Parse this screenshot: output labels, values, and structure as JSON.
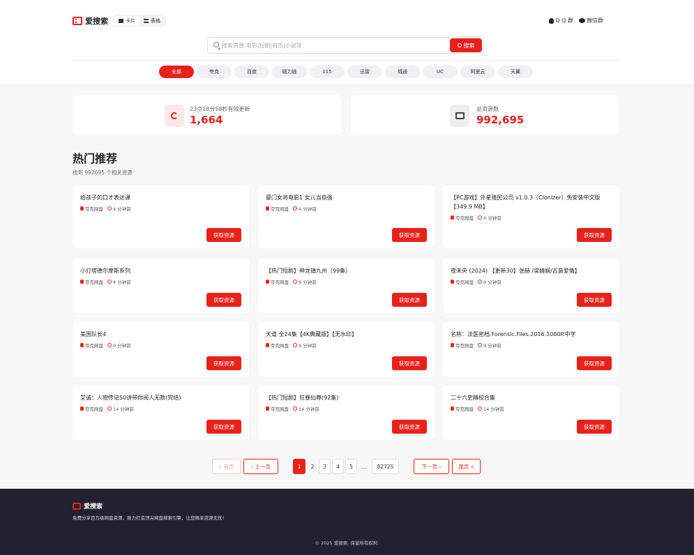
{
  "header": {
    "logo_text": "爱搜索",
    "view_toggle": [
      {
        "label": "卡片",
        "icon": "grid-icon",
        "active": true
      },
      {
        "label": "表格",
        "icon": "list-icon",
        "active": false
      }
    ],
    "groups": [
      {
        "label": "Q Q 群",
        "icon": "qq-icon"
      },
      {
        "label": "微信群",
        "icon": "wechat-icon"
      }
    ]
  },
  "search": {
    "placeholder": "搜索资源:电影|短剧|音乐|小说等",
    "button_label": "搜索"
  },
  "tabs": [
    "全部",
    "夸克",
    "百度",
    "磁力链",
    "115",
    "迅雷",
    "城通",
    "UC",
    "阿里云",
    "天翼"
  ],
  "stats": {
    "update": {
      "label": "23点18分58秒有效更新",
      "value": "1,664"
    },
    "total": {
      "label": "总资源数",
      "value": "992,695"
    }
  },
  "section": {
    "title": "热门推荐",
    "subtitle": "找到 992695 个相关资源"
  },
  "cards": [
    {
      "title": "给孩子的口才表达课",
      "source": "夸克网盘",
      "time": "4 分钟前"
    },
    {
      "title": "豪门女将电影1 女儿当自强",
      "source": "夸克网盘",
      "time": "4 分钟前"
    },
    {
      "title": "【PC游戏】外星殖民公司 v1.0.3（Clonizer）免安装中文版【349.9 MB】",
      "source": "夸克网盘",
      "time": "4 分钟前"
    },
    {
      "title": "小灯塔德尔摩斯系列",
      "source": "夸克网盘",
      "time": "4 分钟前"
    },
    {
      "title": "【热门短剧】神龙镇九州（99集）",
      "source": "夸克网盘",
      "time": "9 分钟前"
    },
    {
      "title": "夜未央 (2024) 【更新30】张赫 /梁婧娴/古装爱情】",
      "source": "夸克网盘",
      "time": "9 分钟前"
    },
    {
      "title": "美国队长4",
      "source": "夸克网盘",
      "time": "9 分钟前"
    },
    {
      "title": "天道 全24集【4K典藏版】【无水印】",
      "source": "夸克网盘",
      "time": "9 分钟前"
    },
    {
      "title": "名称：法医密档.Forensic.Files.2016.1080P.中字",
      "source": "夸克网盘",
      "time": "9 分钟前"
    },
    {
      "title": "艾诚：人物传记50讲带你阅人无数(完结)",
      "source": "夸克网盘",
      "time": "14 分钟前"
    },
    {
      "title": "【热门短剧】狂暴仙尊(92集)",
      "source": "夸克网盘",
      "time": "14 分钟前"
    },
    {
      "title": "二十六史精校合集",
      "source": "夸克网盘",
      "time": "14 分钟前"
    }
  ],
  "get_button_label": "获取资源",
  "pagination": {
    "first": "« 首页",
    "prev": "‹ 上一页",
    "pages": [
      "1",
      "2",
      "3",
      "4",
      "5"
    ],
    "ellipsis": "...",
    "last_page": "82725",
    "next": "下一页 ›",
    "last": "尾页 »"
  },
  "footer": {
    "brand": "爱搜索",
    "description": "免费分享百万级网盘资源，致力打造顶尖网盘搜索引擎，让您畅享资源无忧！",
    "copyright": "© 2025 爱搜索. 保留所有权利."
  },
  "colors": {
    "accent": "#e8211a",
    "footer_bg": "#202230"
  }
}
